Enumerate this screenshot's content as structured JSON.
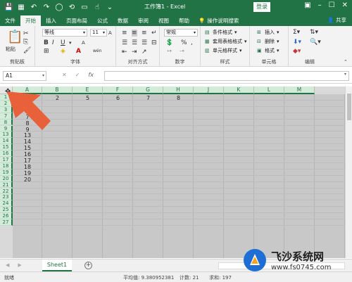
{
  "app": {
    "title": "工作簿1 - Excel",
    "login": "登录",
    "share": "共享"
  },
  "tabs": [
    {
      "label": "文件"
    },
    {
      "label": "开始"
    },
    {
      "label": "插入"
    },
    {
      "label": "页面布局"
    },
    {
      "label": "公式"
    },
    {
      "label": "数据"
    },
    {
      "label": "审阅"
    },
    {
      "label": "视图"
    },
    {
      "label": "帮助"
    }
  ],
  "tell_me": "操作说明搜索",
  "ribbon": {
    "clipboard": {
      "paste": "粘贴",
      "label": "剪贴板"
    },
    "font": {
      "name": "等线",
      "size": "11",
      "label": "字体",
      "bold": "B",
      "italic": "I",
      "underline": "U",
      "grow": "A",
      "shrink": "A",
      "color": "A",
      "wen": "wén"
    },
    "align": {
      "label": "对齐方式"
    },
    "number": {
      "format": "常规",
      "label": "数字",
      "percent": "%",
      "comma": ","
    },
    "styles": {
      "conditional": "条件格式",
      "table": "套用表格格式",
      "cell": "单元格样式",
      "label": "样式"
    },
    "cells": {
      "insert": "插入",
      "delete": "删除",
      "format": "格式",
      "label": "单元格"
    },
    "edit": {
      "label": "编辑"
    }
  },
  "formula_bar": {
    "name_box": "A1",
    "cancel": "✕",
    "enter": "✓",
    "fx": "fx",
    "value": ""
  },
  "columns": [
    "A",
    "B",
    "E",
    "F",
    "G",
    "H",
    "J",
    "K",
    "L",
    "M"
  ],
  "rows": [
    "1",
    "2",
    "3",
    "7",
    "8",
    "9",
    "13",
    "14",
    "15",
    "16",
    "17",
    "18",
    "19",
    "20",
    "21",
    "22",
    "23",
    "24",
    "25",
    "26",
    "27"
  ],
  "cells": {
    "row1": [
      "2",
      "5",
      "6",
      "7",
      "8"
    ],
    "colA": [
      "7",
      "8",
      "9",
      "13",
      "14",
      "15",
      "16",
      "17",
      "18",
      "19",
      "20"
    ]
  },
  "sheet": {
    "tab": "Sheet1"
  },
  "status": {
    "ready": "就绪",
    "average": "平均值: 9.380952381",
    "count": "计数: 21",
    "sum": "求和: 197"
  },
  "watermark": {
    "title": "飞沙系统网",
    "url": "www.fs0745.com"
  },
  "colors": {
    "excel_green": "#217346",
    "arrow": "#e8613a"
  }
}
